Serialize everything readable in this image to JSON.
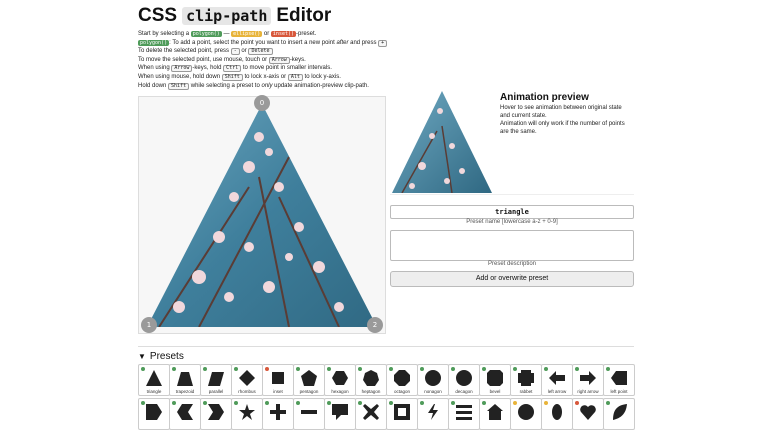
{
  "header": {
    "title_prefix": "CSS",
    "title_code": "clip-path",
    "title_suffix": "Editor"
  },
  "intro": {
    "l1a": "Start by selecting a",
    "l1b": "polygon()",
    "l1c": "—",
    "l1d": "ellipse()",
    "l1e": "or",
    "l1f": "inset()",
    "l1g": "-preset.",
    "l2a": "polygon()",
    "l2b": ": To add a point, select the point you want to insert a new point",
    "l2c": "after",
    "l2d": "and press",
    "l2e": "+",
    "l3a": "To delete the selected point, press",
    "l3b": "-",
    "l3c": "or",
    "l3d": "Delete",
    "l4a": "To move the selected point, use mouse, touch or",
    "l4b": "Arrow",
    "l4c": "-keys.",
    "l5a": "When using",
    "l5b": "Arrow",
    "l5c": "-keys, hold",
    "l5d": "Ctrl",
    "l5e": "to move point in smaller intervals.",
    "l6a": "When using mouse, hold down",
    "l6b": "Shift",
    "l6c": "to lock x-axis or",
    "l6d": "Alt",
    "l6e": "to lock y-axis.",
    "l7a": "Hold down",
    "l7b": "Shift",
    "l7c": "while selecting a preset to",
    "l7d": "only",
    "l7e": "update animation-preview clip-path."
  },
  "editor": {
    "handles": [
      "0",
      "1",
      "2"
    ]
  },
  "preview": {
    "title": "Animation preview",
    "desc1": "Hover to see animation between original state and current state.",
    "desc2": "Animation will only work if the number of points are the same."
  },
  "form": {
    "preset_name_value": "triangle",
    "preset_name_hint": "Preset name [lowercase a-z + 0-9]",
    "preset_desc_hint": "Preset description",
    "add_button": "Add or overwrite preset"
  },
  "presets": {
    "heading": "Presets",
    "row1": [
      "triangle",
      "trapezoid",
      "parallel",
      "rhombus",
      "inset",
      "pentagon",
      "hexagon",
      "heptagon",
      "octagon",
      "nonagon",
      "decagon",
      "bevel",
      "rabbet",
      "left arrow",
      "right arrow",
      "left point"
    ],
    "row2_icons": [
      "right-point-icon",
      "left-chevron-icon",
      "right-chevron-icon",
      "star-icon",
      "cross-icon",
      "minus-icon",
      "message-icon",
      "close-icon",
      "frame-icon",
      "bolt-icon",
      "menu-icon",
      "house-icon",
      "circle-icon",
      "ellipse-icon",
      "heart-icon",
      "leaf-icon"
    ]
  },
  "colors": {
    "accent_green": "#4f9b5a",
    "accent_yellow": "#e8b43a",
    "accent_red": "#d8583c"
  }
}
